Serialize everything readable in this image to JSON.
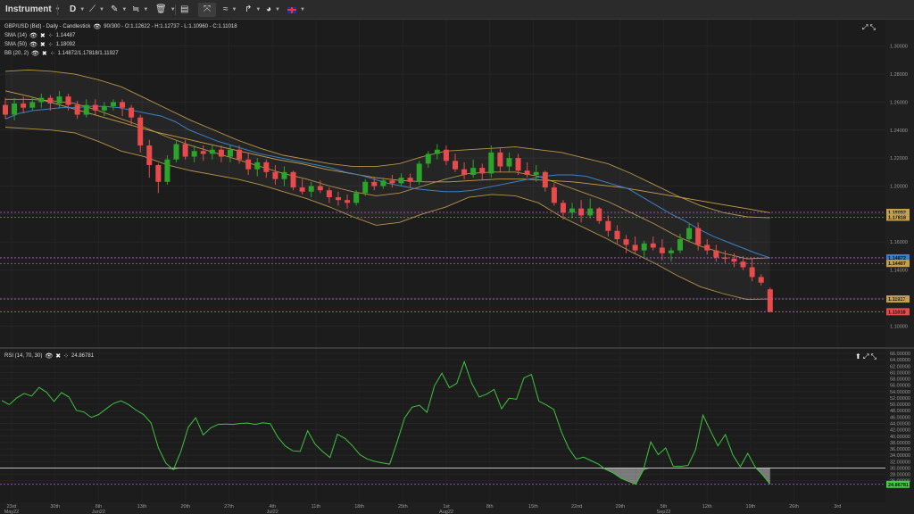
{
  "toolbar": {
    "instrument_label": "Instrument",
    "timeframe_label": "D"
  },
  "legend": {
    "main": "GBP/USD (Bid) - Daily - Candlestick",
    "ohlc": "90/300 - O:1.12622 - H:1.12737 - L:1.10960 - C:1.11018",
    "sma14_name": "SMA (14)",
    "sma14_value": "1.14487",
    "sma50_name": "SMA (50)",
    "sma50_value": "1.18092",
    "bb_name": "BB (20, 2)",
    "bb_value": "1.14872/1.17818/1.11927",
    "rsi_name": "RSI (14, 70, 30)",
    "rsi_value": "24.86781"
  },
  "colors": {
    "up": "#2aa52a",
    "down": "#e74b4b",
    "sma14": "#3a82c8",
    "sma50": "#c8a048",
    "bb": "#b8944a",
    "rsi": "#3fc43f"
  },
  "price_axis": {
    "min": 1.09,
    "max": 1.31,
    "ticks": [
      "1.30000",
      "1.28000",
      "1.26000",
      "1.24000",
      "1.22000",
      "1.20000",
      "1.18000",
      "1.16000",
      "1.14000",
      "1.12000",
      "1.10000"
    ]
  },
  "price_markers": [
    {
      "label": "1.18092",
      "value": 1.1812,
      "color": "#c8a048"
    },
    {
      "label": "1.17818",
      "value": 1.1777,
      "color": "#c8a048"
    },
    {
      "label": "1.14872",
      "value": 1.1487,
      "color": "#3a82c8"
    },
    {
      "label": "1.14407",
      "value": 1.1447,
      "color": "#c8a048"
    },
    {
      "label": "1.11927",
      "value": 1.1193,
      "color": "#c8a048"
    },
    {
      "label": "1.11018",
      "value": 1.1102,
      "color": "#e74b4b"
    }
  ],
  "rsi_axis": {
    "min": 22,
    "max": 66,
    "ticks": [
      "66.00000",
      "64.00000",
      "62.00000",
      "60.00000",
      "58.00000",
      "56.00000",
      "54.00000",
      "52.00000",
      "50.00000",
      "48.00000",
      "46.00000",
      "44.00000",
      "42.00000",
      "40.00000",
      "38.00000",
      "36.00000",
      "34.00000",
      "32.00000",
      "30.00000",
      "28.00000",
      "26.00000"
    ],
    "marker_label": "24.86781",
    "marker_value": 24.87
  },
  "date_axis": [
    {
      "label": "23rd",
      "sub": "May22"
    },
    {
      "label": "30th",
      "sub": ""
    },
    {
      "label": "6th",
      "sub": "Jun22"
    },
    {
      "label": "13th",
      "sub": ""
    },
    {
      "label": "20th",
      "sub": ""
    },
    {
      "label": "27th",
      "sub": ""
    },
    {
      "label": "4th",
      "sub": "Jul22"
    },
    {
      "label": "11th",
      "sub": ""
    },
    {
      "label": "18th",
      "sub": ""
    },
    {
      "label": "25th",
      "sub": ""
    },
    {
      "label": "1st",
      "sub": "Aug22"
    },
    {
      "label": "8th",
      "sub": ""
    },
    {
      "label": "15th",
      "sub": ""
    },
    {
      "label": "22nd",
      "sub": ""
    },
    {
      "label": "29th",
      "sub": ""
    },
    {
      "label": "5th",
      "sub": "Sep22"
    },
    {
      "label": "12th",
      "sub": ""
    },
    {
      "label": "19th",
      "sub": ""
    },
    {
      "label": "26th",
      "sub": ""
    },
    {
      "label": "3rd",
      "sub": ""
    }
  ],
  "chart_data": {
    "type": "candlestick",
    "title": "GBP/USD (Bid) - Daily - Candlestick",
    "ylim": [
      1.09,
      1.31
    ],
    "candles": [
      [
        1.258,
        1.263,
        1.248,
        1.251
      ],
      [
        1.251,
        1.263,
        1.247,
        1.259
      ],
      [
        1.259,
        1.264,
        1.252,
        1.256
      ],
      [
        1.256,
        1.264,
        1.254,
        1.26
      ],
      [
        1.26,
        1.266,
        1.256,
        1.263
      ],
      [
        1.263,
        1.265,
        1.254,
        1.259
      ],
      [
        1.259,
        1.268,
        1.256,
        1.264
      ],
      [
        1.264,
        1.266,
        1.254,
        1.258
      ],
      [
        1.258,
        1.261,
        1.248,
        1.251
      ],
      [
        1.251,
        1.262,
        1.249,
        1.258
      ],
      [
        1.258,
        1.262,
        1.251,
        1.254
      ],
      [
        1.254,
        1.26,
        1.25,
        1.257
      ],
      [
        1.257,
        1.262,
        1.254,
        1.26
      ],
      [
        1.26,
        1.262,
        1.25,
        1.256
      ],
      [
        1.256,
        1.258,
        1.244,
        1.249
      ],
      [
        1.249,
        1.251,
        1.224,
        1.229
      ],
      [
        1.229,
        1.233,
        1.206,
        1.215
      ],
      [
        1.215,
        1.216,
        1.195,
        1.203
      ],
      [
        1.203,
        1.222,
        1.201,
        1.219
      ],
      [
        1.219,
        1.233,
        1.217,
        1.23
      ],
      [
        1.23,
        1.233,
        1.219,
        1.221
      ],
      [
        1.221,
        1.229,
        1.217,
        1.225
      ],
      [
        1.225,
        1.229,
        1.218,
        1.223
      ],
      [
        1.223,
        1.23,
        1.219,
        1.226
      ],
      [
        1.226,
        1.229,
        1.217,
        1.221
      ],
      [
        1.221,
        1.229,
        1.217,
        1.226
      ],
      [
        1.226,
        1.229,
        1.216,
        1.219
      ],
      [
        1.219,
        1.224,
        1.208,
        1.212
      ],
      [
        1.212,
        1.22,
        1.207,
        1.217
      ],
      [
        1.217,
        1.219,
        1.206,
        1.21
      ],
      [
        1.21,
        1.215,
        1.201,
        1.205
      ],
      [
        1.205,
        1.214,
        1.2,
        1.21
      ],
      [
        1.21,
        1.211,
        1.197,
        1.199
      ],
      [
        1.199,
        1.205,
        1.194,
        1.196
      ],
      [
        1.196,
        1.203,
        1.192,
        1.2
      ],
      [
        1.2,
        1.204,
        1.195,
        1.197
      ],
      [
        1.197,
        1.199,
        1.188,
        1.192
      ],
      [
        1.192,
        1.196,
        1.186,
        1.19
      ],
      [
        1.19,
        1.194,
        1.184,
        1.188
      ],
      [
        1.188,
        1.197,
        1.186,
        1.195
      ],
      [
        1.195,
        1.205,
        1.193,
        1.203
      ],
      [
        1.203,
        1.206,
        1.197,
        1.2
      ],
      [
        1.2,
        1.206,
        1.198,
        1.204
      ],
      [
        1.204,
        1.208,
        1.199,
        1.202
      ],
      [
        1.202,
        1.209,
        1.2,
        1.206
      ],
      [
        1.206,
        1.209,
        1.199,
        1.203
      ],
      [
        1.203,
        1.218,
        1.201,
        1.216
      ],
      [
        1.216,
        1.225,
        1.213,
        1.223
      ],
      [
        1.223,
        1.23,
        1.219,
        1.226
      ],
      [
        1.226,
        1.229,
        1.215,
        1.218
      ],
      [
        1.218,
        1.223,
        1.21,
        1.212
      ],
      [
        1.212,
        1.217,
        1.205,
        1.208
      ],
      [
        1.208,
        1.219,
        1.206,
        1.213
      ],
      [
        1.213,
        1.216,
        1.204,
        1.209
      ],
      [
        1.209,
        1.229,
        1.206,
        1.224
      ],
      [
        1.224,
        1.227,
        1.21,
        1.214
      ],
      [
        1.214,
        1.224,
        1.21,
        1.22
      ],
      [
        1.22,
        1.223,
        1.208,
        1.211
      ],
      [
        1.211,
        1.217,
        1.206,
        1.208
      ],
      [
        1.208,
        1.215,
        1.203,
        1.21
      ],
      [
        1.21,
        1.211,
        1.196,
        1.199
      ],
      [
        1.199,
        1.202,
        1.186,
        1.188
      ],
      [
        1.188,
        1.19,
        1.176,
        1.181
      ],
      [
        1.181,
        1.188,
        1.177,
        1.184
      ],
      [
        1.184,
        1.19,
        1.174,
        1.179
      ],
      [
        1.179,
        1.191,
        1.177,
        1.184
      ],
      [
        1.184,
        1.185,
        1.173,
        1.175
      ],
      [
        1.175,
        1.179,
        1.164,
        1.168
      ],
      [
        1.168,
        1.172,
        1.159,
        1.162
      ],
      [
        1.162,
        1.165,
        1.152,
        1.158
      ],
      [
        1.158,
        1.164,
        1.152,
        1.154
      ],
      [
        1.154,
        1.161,
        1.148,
        1.159
      ],
      [
        1.159,
        1.164,
        1.154,
        1.156
      ],
      [
        1.156,
        1.162,
        1.147,
        1.152
      ],
      [
        1.152,
        1.156,
        1.146,
        1.154
      ],
      [
        1.154,
        1.166,
        1.152,
        1.162
      ],
      [
        1.162,
        1.173,
        1.16,
        1.17
      ],
      [
        1.17,
        1.174,
        1.154,
        1.158
      ],
      [
        1.158,
        1.162,
        1.151,
        1.154
      ],
      [
        1.154,
        1.158,
        1.146,
        1.149
      ],
      [
        1.149,
        1.154,
        1.145,
        1.148
      ],
      [
        1.148,
        1.152,
        1.142,
        1.146
      ],
      [
        1.146,
        1.15,
        1.14,
        1.142
      ],
      [
        1.142,
        1.148,
        1.132,
        1.135
      ],
      [
        1.135,
        1.137,
        1.129,
        1.131
      ],
      [
        1.1262,
        1.1274,
        1.1096,
        1.1102
      ]
    ],
    "rsi": [
      51.2,
      49.9,
      52.0,
      53.4,
      52.6,
      55.3,
      53.8,
      50.9,
      53.7,
      52.3,
      48.1,
      47.6,
      45.9,
      46.8,
      48.6,
      50.3,
      51.1,
      49.9,
      48.2,
      46.8,
      44.2,
      36.3,
      31.5,
      29.5,
      35.1,
      42.8,
      45.8,
      40.4,
      42.6,
      43.7,
      43.8,
      43.7,
      44.0,
      44.1,
      43.7,
      44.2,
      43.9,
      39.7,
      36.9,
      35.4,
      35.2,
      41.7,
      37.5,
      35.2,
      33.3,
      40.6,
      39.3,
      37.0,
      34.2,
      32.8,
      32.1,
      31.6,
      31.2,
      38.2,
      45.7,
      49.1,
      49.7,
      47.5,
      55.8,
      59.8,
      55.2,
      56.6,
      63.4,
      56.6,
      52.3,
      53.2,
      54.7,
      48.6,
      51.9,
      51.6,
      58.3,
      59.4,
      51.0,
      49.8,
      48.4,
      41.5,
      36.2,
      32.8,
      33.4,
      32.3,
      31.2,
      29.5,
      28.4,
      26.8,
      25.8,
      24.9,
      29.3,
      38.2,
      34.2,
      36.3,
      30.6,
      30.5,
      30.8,
      35.7,
      46.6,
      41.7,
      37.0,
      40.5,
      34.1,
      30.4,
      34.6,
      30.3,
      27.8,
      24.9
    ],
    "sma14": [
      1.248,
      1.252,
      1.254,
      1.255,
      1.256,
      1.256,
      1.257,
      1.257,
      1.256,
      1.254,
      1.252,
      1.25,
      1.246,
      1.24,
      1.236,
      1.232,
      1.229,
      1.226,
      1.223,
      1.221,
      1.219,
      1.217,
      1.215,
      1.213,
      1.21,
      1.208,
      1.205,
      1.202,
      1.2,
      1.198,
      1.197,
      1.196,
      1.196,
      1.197,
      1.199,
      1.201,
      1.203,
      1.205,
      1.207,
      1.208,
      1.208,
      1.207,
      1.204,
      1.201,
      1.198,
      1.192,
      1.186,
      1.18,
      1.175,
      1.169,
      1.164,
      1.16,
      1.156,
      1.152,
      1.1487
    ],
    "sma50": [
      1.268,
      1.264,
      1.259,
      1.254,
      1.249,
      1.244,
      1.239,
      1.235,
      1.231,
      1.227,
      1.223,
      1.219,
      1.216,
      1.212,
      1.209,
      1.206,
      1.204,
      1.203,
      1.203,
      1.204,
      1.205,
      1.205,
      1.204,
      1.203,
      1.201,
      1.199,
      1.196,
      1.193,
      1.19,
      1.187,
      1.184,
      1.1809
    ],
    "bb_upper": [
      1.282,
      1.283,
      1.282,
      1.28,
      1.276,
      1.271,
      1.263,
      1.255,
      1.247,
      1.24,
      1.233,
      1.227,
      1.222,
      1.219,
      1.216,
      1.214,
      1.214,
      1.216,
      1.221,
      1.225,
      1.226,
      1.227,
      1.228,
      1.226,
      1.224,
      1.22,
      1.216,
      1.209,
      1.201,
      1.193,
      1.186,
      1.181,
      1.178,
      1.1773
    ],
    "bb_mid": [
      1.262,
      1.262,
      1.261,
      1.259,
      1.254,
      1.248,
      1.242,
      1.235,
      1.229,
      1.224,
      1.219,
      1.214,
      1.209,
      1.205,
      1.2,
      1.196,
      1.193,
      1.195,
      1.2,
      1.205,
      1.209,
      1.21,
      1.21,
      1.207,
      1.201,
      1.195,
      1.189,
      1.181,
      1.173,
      1.164,
      1.157,
      1.152,
      1.148,
      1.1487
    ],
    "bb_lower": [
      1.242,
      1.241,
      1.24,
      1.238,
      1.232,
      1.225,
      1.221,
      1.215,
      1.211,
      1.208,
      1.205,
      1.201,
      1.196,
      1.191,
      1.185,
      1.178,
      1.172,
      1.174,
      1.18,
      1.185,
      1.192,
      1.194,
      1.193,
      1.188,
      1.178,
      1.17,
      1.162,
      1.153,
      1.145,
      1.136,
      1.128,
      1.123,
      1.119,
      1.1193
    ]
  }
}
